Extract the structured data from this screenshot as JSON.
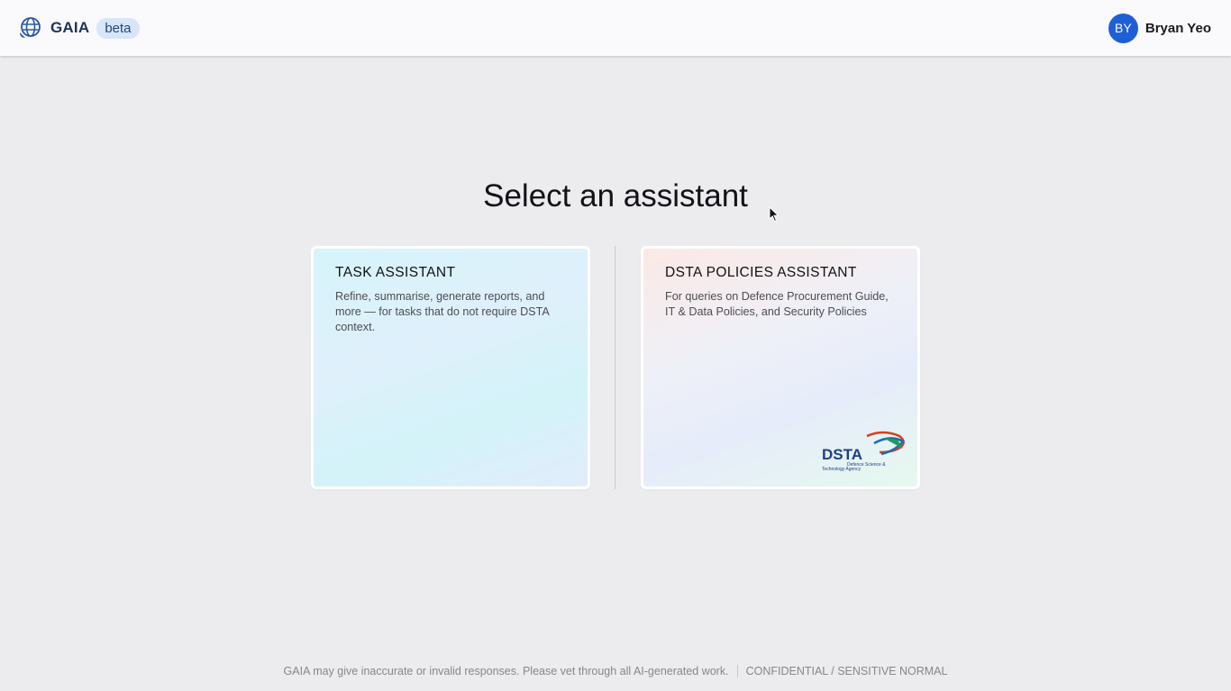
{
  "header": {
    "app_name": "GAIA",
    "badge": "beta",
    "logo_icon": "globe-chat-icon",
    "user": {
      "initials": "BY",
      "name": "Bryan Yeo",
      "avatar_color": "#1f5fd6"
    }
  },
  "main": {
    "title": "Select an assistant",
    "cards": [
      {
        "title": "TASK ASSISTANT",
        "description": "Refine, summarise, generate reports, and more — for tasks that do not require DSTA context."
      },
      {
        "title": "DSTA POLICIES ASSISTANT",
        "description": "For queries on Defence Procurement Guide, IT & Data Policies, and Security Policies",
        "logo": {
          "name": "DSTA",
          "tagline_line1": "Defence Science &",
          "tagline_line2": "Technology Agency"
        }
      }
    ]
  },
  "footer": {
    "disclaimer": "GAIA may give inaccurate or invalid responses. Please vet through all AI-generated work.",
    "classification": "CONFIDENTIAL / SENSITIVE NORMAL"
  },
  "colors": {
    "brand_navy": "#16345c",
    "badge_bg": "#d7e6fa",
    "page_bg": "#ecebee"
  }
}
